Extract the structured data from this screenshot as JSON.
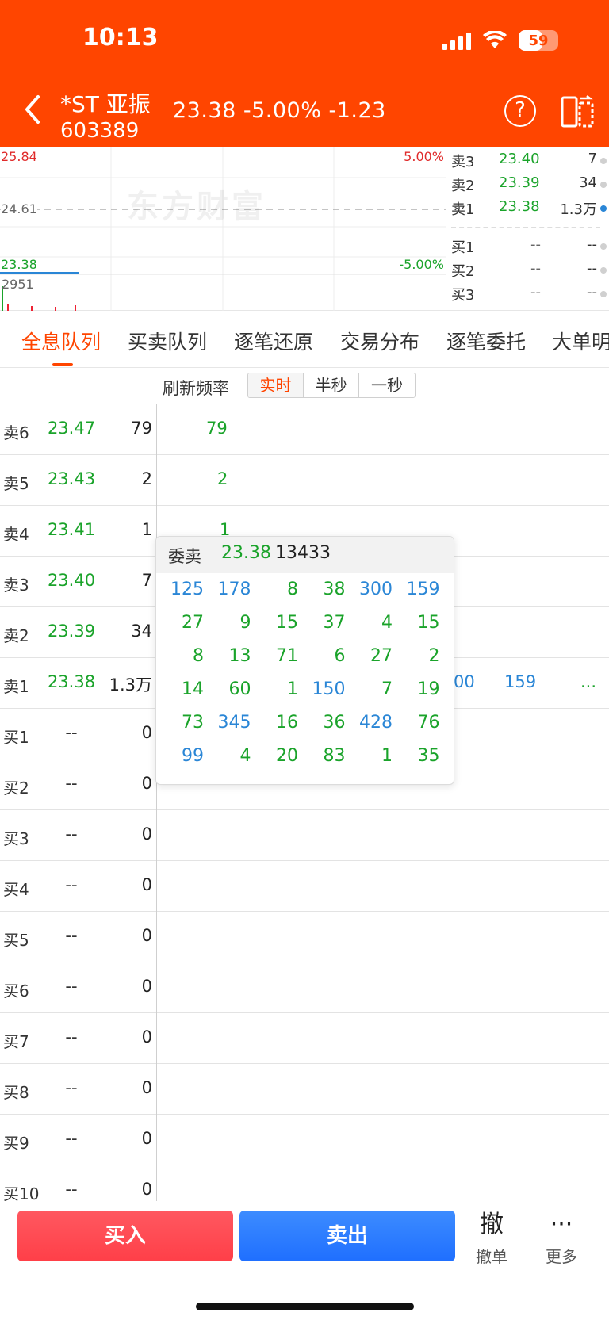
{
  "status": {
    "time": "10:13",
    "battery": "59"
  },
  "header": {
    "name": "*ST 亚振",
    "code": "603389",
    "quote": "23.38  -5.00%  -1.23",
    "help": "?"
  },
  "chart": {
    "high": "25.84",
    "pre_close": "24.61",
    "low": "23.38",
    "up_pct": "5.00%",
    "down_pct": "-5.00%",
    "volume": "2951",
    "watermark": "东方财富"
  },
  "depth": [
    {
      "k": "卖3",
      "p": "23.40",
      "v": "7"
    },
    {
      "k": "卖2",
      "p": "23.39",
      "v": "34"
    },
    {
      "k": "卖1",
      "p": "23.38",
      "v": "1.3万"
    },
    {
      "k": "买1",
      "p": "--",
      "v": "--"
    },
    {
      "k": "买2",
      "p": "--",
      "v": "--"
    },
    {
      "k": "买3",
      "p": "--",
      "v": "--"
    }
  ],
  "tabs": [
    "全息队列",
    "买卖队列",
    "逐笔还原",
    "交易分布",
    "逐笔委托",
    "大单明"
  ],
  "refresh": {
    "label": "刷新频率",
    "options": [
      "实时",
      "半秒",
      "一秒"
    ]
  },
  "book": [
    {
      "lbl": "卖6",
      "pr": "23.47",
      "vol": "79",
      "q": "79"
    },
    {
      "lbl": "卖5",
      "pr": "23.43",
      "vol": "2",
      "q": "2"
    },
    {
      "lbl": "卖4",
      "pr": "23.41",
      "vol": "1",
      "q": "1"
    },
    {
      "lbl": "卖3",
      "pr": "23.40",
      "vol": "7",
      "q": ""
    },
    {
      "lbl": "卖2",
      "pr": "23.39",
      "vol": "34",
      "q": ""
    },
    {
      "lbl": "卖1",
      "pr": "23.38",
      "vol": "1.3万",
      "q": ""
    },
    {
      "lbl": "买1",
      "pr": "--",
      "vol": "0",
      "q": ""
    },
    {
      "lbl": "买2",
      "pr": "--",
      "vol": "0",
      "q": ""
    },
    {
      "lbl": "买3",
      "pr": "--",
      "vol": "0",
      "q": ""
    },
    {
      "lbl": "买4",
      "pr": "--",
      "vol": "0",
      "q": ""
    },
    {
      "lbl": "买5",
      "pr": "--",
      "vol": "0",
      "q": ""
    },
    {
      "lbl": "买6",
      "pr": "--",
      "vol": "0",
      "q": ""
    },
    {
      "lbl": "买7",
      "pr": "--",
      "vol": "0",
      "q": ""
    },
    {
      "lbl": "买8",
      "pr": "--",
      "vol": "0",
      "q": ""
    },
    {
      "lbl": "买9",
      "pr": "--",
      "vol": "0",
      "q": ""
    },
    {
      "lbl": "买10",
      "pr": "--",
      "vol": "0",
      "q": ""
    }
  ],
  "sell1_queue_tail": {
    "a": "00",
    "b": "159",
    "more": "..."
  },
  "popup": {
    "title": "委卖",
    "price": "23.38",
    "volume": "13433",
    "rows": [
      [
        "125",
        "178",
        "8",
        "38",
        "300",
        "159"
      ],
      [
        "27",
        "9",
        "15",
        "37",
        "4",
        "15"
      ],
      [
        "8",
        "13",
        "71",
        "6",
        "27",
        "2"
      ],
      [
        "14",
        "60",
        "1",
        "150",
        "7",
        "19"
      ],
      [
        "73",
        "345",
        "16",
        "36",
        "428",
        "76"
      ],
      [
        "99",
        "4",
        "20",
        "83",
        "1",
        "35"
      ]
    ],
    "blue_threshold": 99
  },
  "actions": {
    "buy": "买入",
    "sell": "卖出",
    "cancel_icon": "撤",
    "cancel": "撤单",
    "more_icon": "···",
    "more": "更多"
  }
}
